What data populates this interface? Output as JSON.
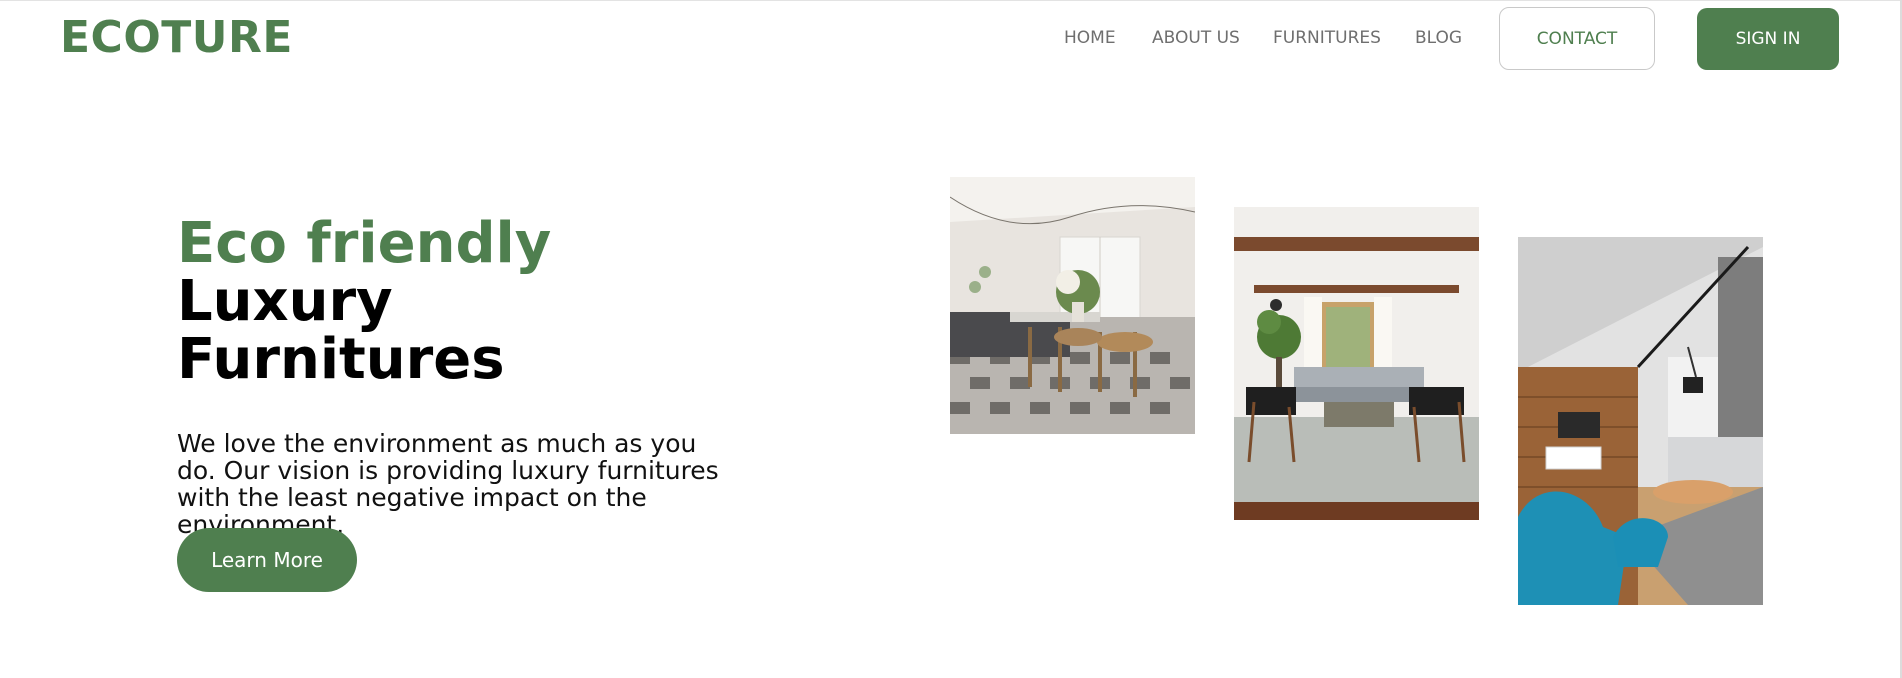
{
  "brand": {
    "logo": "ECOTURE"
  },
  "nav": {
    "home": "HOME",
    "about": "ABOUT US",
    "furnitures": "FURNITURES",
    "blog": "BLOG",
    "contact": "CONTACT",
    "signin": "SIGN IN"
  },
  "hero": {
    "title_line1": "Eco friendly",
    "title_line2": "Luxury",
    "title_line3": "Furnitures",
    "description": "We love the environment as much as you do. Our vision is providing luxury furnitures with the least negative impact on the environment.",
    "cta": "Learn More"
  },
  "colors": {
    "brand_green": "#4f7f4f",
    "nav_text": "#6f6f6f"
  }
}
